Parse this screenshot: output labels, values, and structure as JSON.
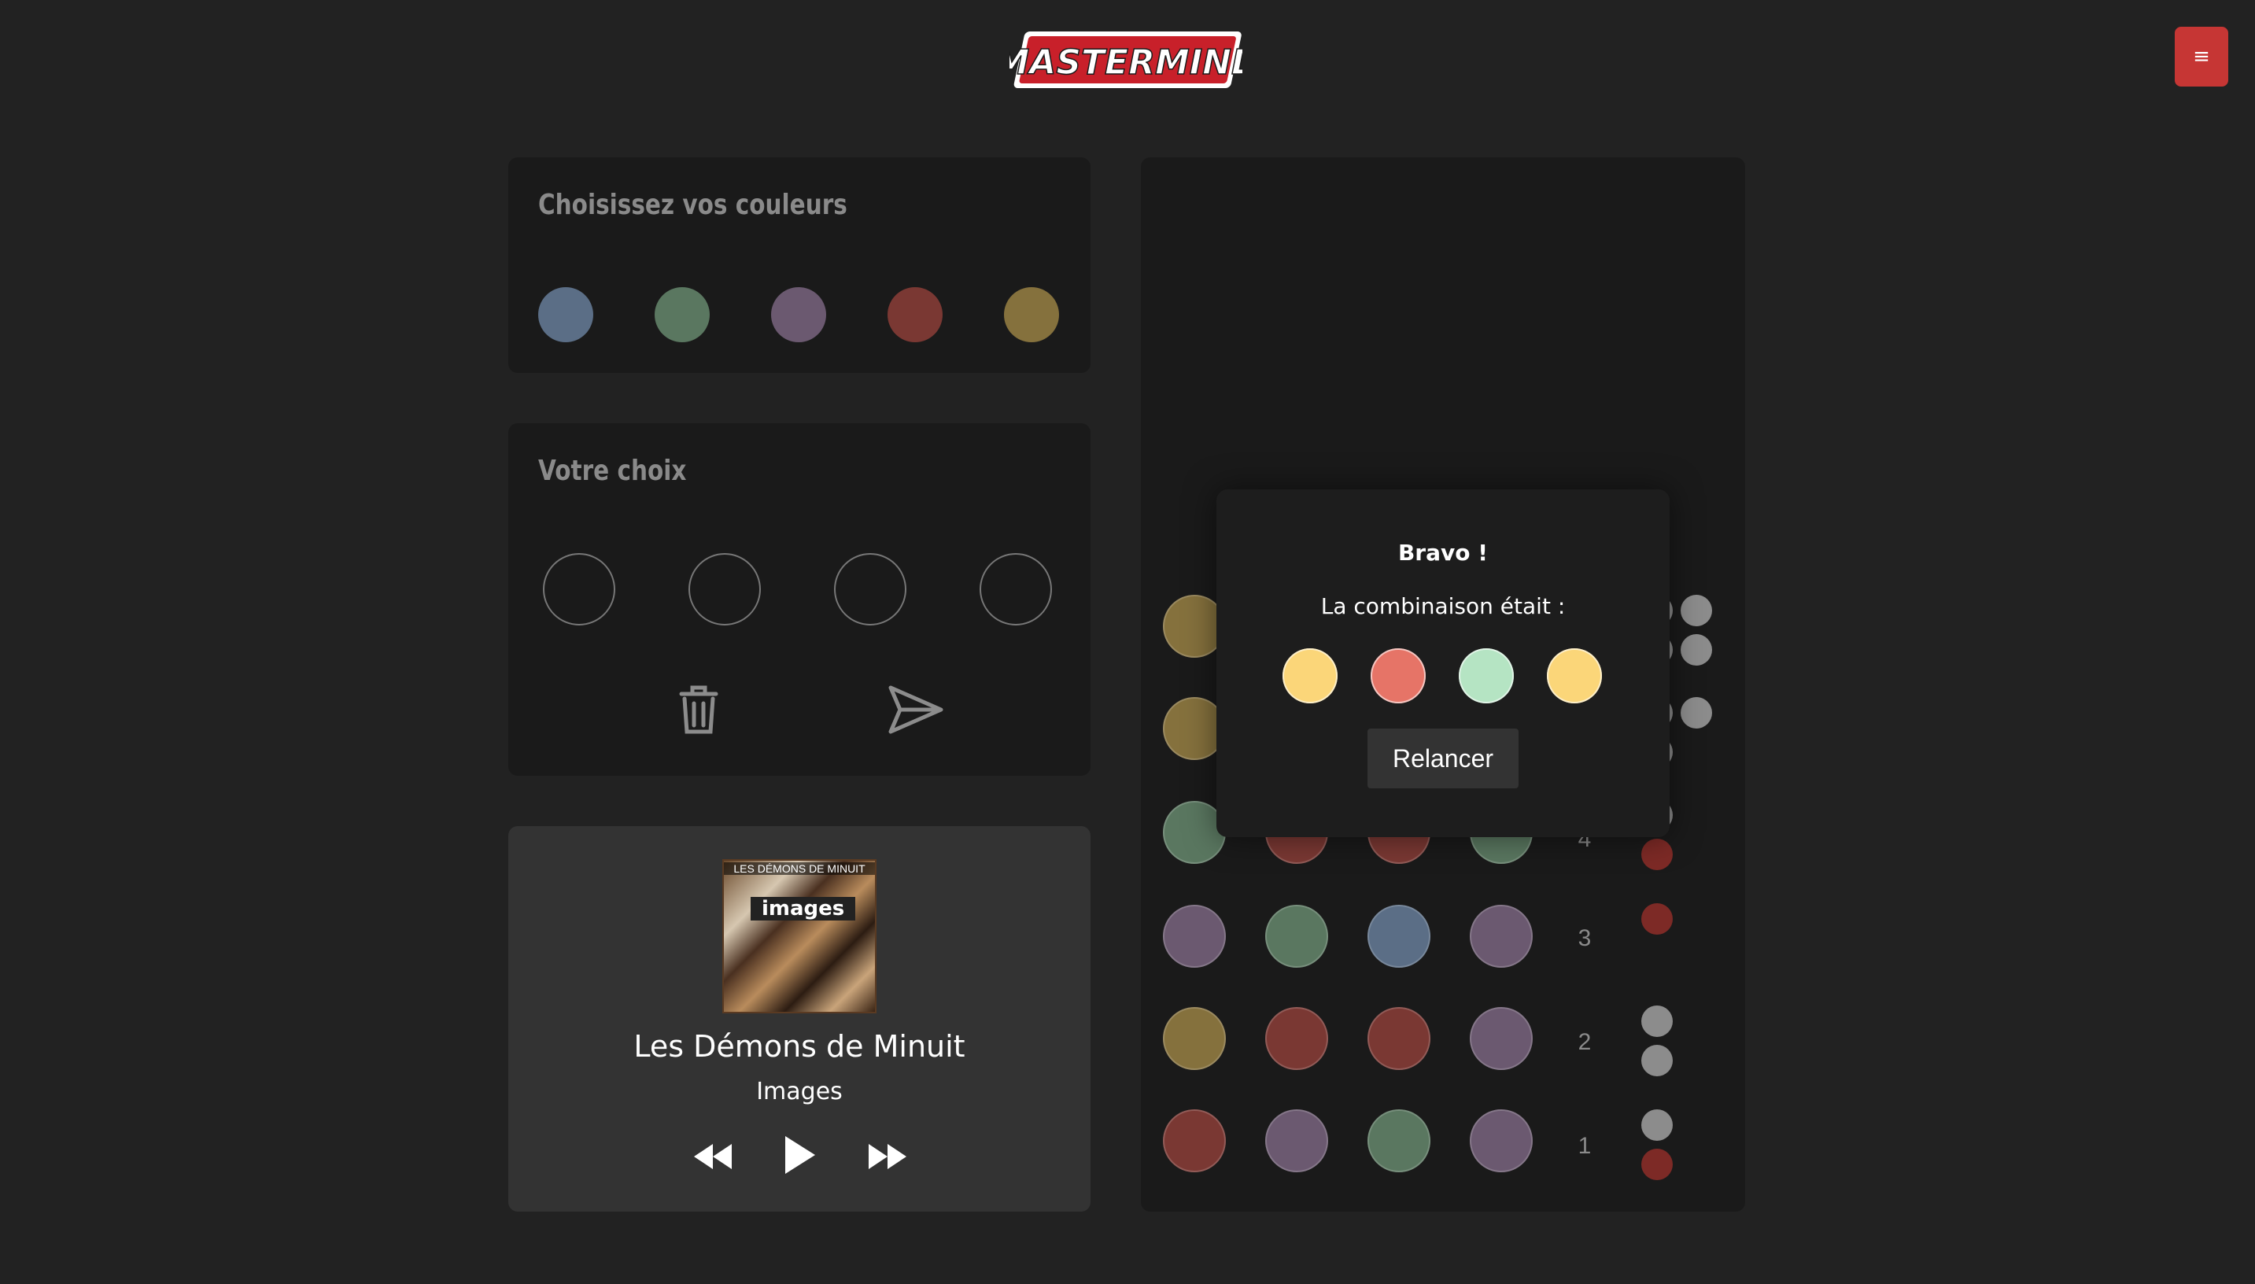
{
  "header": {
    "logo_text": "MASTERMIND",
    "menu_icon": "≡"
  },
  "colors": {
    "blue": "#5b6e86",
    "green": "#5a7760",
    "purple": "#6b5970",
    "red": "#7a3833",
    "olive": "#85713d",
    "sol_yellow": "#fbd679",
    "sol_red": "#e67467",
    "sol_mint": "#b5e4c3",
    "fb_white": "#8c8c8c",
    "fb_red": "#7d2a26"
  },
  "palette": {
    "title": "Choisissez vos couleurs",
    "colors": [
      "blue",
      "green",
      "purple",
      "red",
      "olive"
    ]
  },
  "choice": {
    "title": "Votre choix",
    "slots": 4
  },
  "player": {
    "artist": "Les Démons de Minuit",
    "album": "Images",
    "cover_text_top": "LES DÉMONS DE MINUIT",
    "cover_text_main": "images"
  },
  "board": {
    "rows": [
      {
        "num": "4",
        "pegs": [
          "green",
          "red",
          "red",
          "green"
        ],
        "feedback": [
          "fb_red"
        ]
      },
      {
        "num": "3",
        "pegs": [
          "purple",
          "green",
          "blue",
          "purple"
        ],
        "feedback": [
          "fb_red"
        ]
      },
      {
        "num": "2",
        "pegs": [
          "olive",
          "red",
          "red",
          "purple"
        ],
        "feedback": [
          "fb_white",
          "fb_white"
        ]
      },
      {
        "num": "1",
        "pegs": [
          "red",
          "purple",
          "green",
          "purple"
        ],
        "feedback": [
          "fb_white",
          "fb_red"
        ]
      }
    ],
    "hidden_rows_left_pegs": [
      "olive",
      "olive"
    ]
  },
  "modal": {
    "title": "Bravo !",
    "subtitle": "La combinaison était :",
    "solution": [
      "sol_yellow",
      "sol_red",
      "sol_mint",
      "sol_yellow"
    ],
    "button": "Relancer"
  }
}
